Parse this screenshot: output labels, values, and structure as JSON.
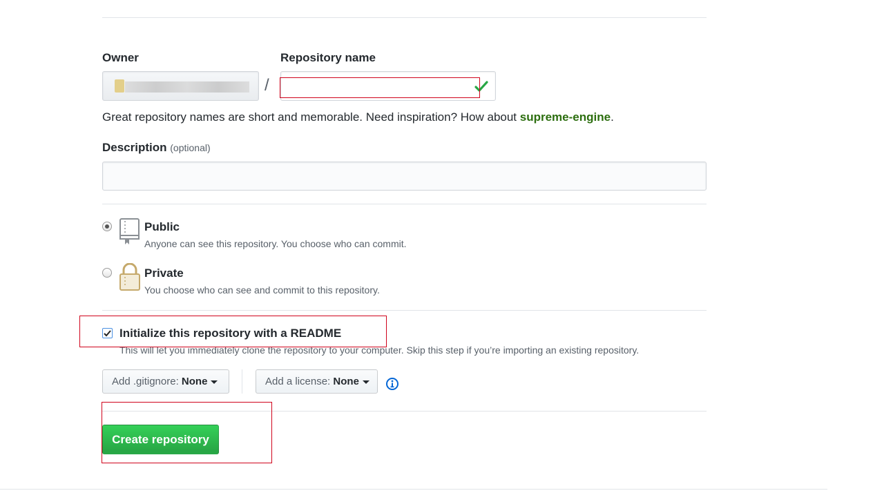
{
  "form": {
    "owner_label": "Owner",
    "separator": "/",
    "repo_name_label": "Repository name",
    "repo_name_value": "",
    "name_hint_prefix": "Great repository names are short and memorable. Need inspiration? How about ",
    "name_suggestion": "supreme-engine",
    "name_hint_suffix": ".",
    "description_label": "Description",
    "description_optional": "(optional)",
    "description_value": ""
  },
  "visibility": {
    "public_title": "Public",
    "public_note": "Anyone can see this repository. You choose who can commit.",
    "private_title": "Private",
    "private_note": "You choose who can see and commit to this repository."
  },
  "init": {
    "readme_label": "Initialize this repository with a README",
    "readme_note": "This will let you immediately clone the repository to your computer. Skip this step if you’re importing an existing repository.",
    "gitignore_label": "Add .gitignore:",
    "gitignore_value": "None",
    "license_label": "Add a license:",
    "license_value": "None"
  },
  "submit": {
    "create_label": "Create repository"
  },
  "colors": {
    "suggestion_green": "#2c6e0f",
    "primary_green": "#28a745",
    "annotation_red": "#d0021b",
    "info_blue": "#0366d6"
  },
  "icons": [
    "check-icon",
    "repo-icon",
    "lock-icon",
    "info-icon",
    "caret-down-icon"
  ]
}
